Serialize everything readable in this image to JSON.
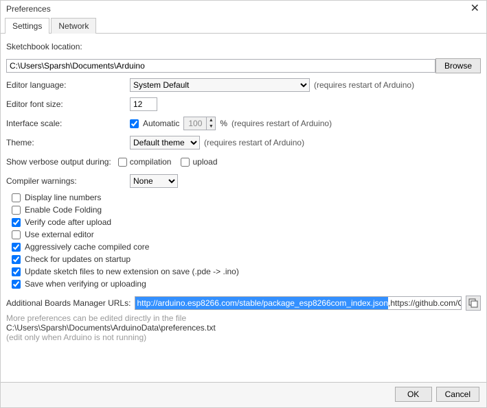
{
  "window": {
    "title": "Preferences"
  },
  "tabs": [
    "Settings",
    "Network"
  ],
  "labels": {
    "sketchbook": "Sketchbook location:",
    "language": "Editor language:",
    "fontsize": "Editor font size:",
    "scale": "Interface scale:",
    "automatic": "Automatic",
    "percent": "%",
    "theme": "Theme:",
    "verbose": "Show verbose output during:",
    "compilation": "compilation",
    "upload": "upload",
    "warnings": "Compiler warnings:",
    "boards_urls": "Additional Boards Manager URLs:"
  },
  "values": {
    "sketchbook": "C:\\Users\\Sparsh\\Documents\\Arduino",
    "language": "System Default",
    "fontsize": "12",
    "scale": "100",
    "theme": "Default theme",
    "warnings": "None",
    "urls_selected": "http://arduino.esp8266.com/stable/package_esp8266com_index.json",
    "urls_rest": ",https://github.com/Optiboot/opt",
    "prefs_path": "C:\\Users\\Sparsh\\Documents\\ArduinoData\\preferences.txt"
  },
  "checks": [
    "Display line numbers",
    "Enable Code Folding",
    "Verify code after upload",
    "Use external editor",
    "Aggressively cache compiled core",
    "Check for updates on startup",
    "Update sketch files to new extension on save (.pde -> .ino)",
    "Save when verifying or uploading"
  ],
  "notes": {
    "restart": "(requires restart of Arduino)",
    "more_prefs": "More preferences can be edited directly in the file",
    "edit_only": "(edit only when Arduino is not running)"
  },
  "buttons": {
    "browse": "Browse",
    "ok": "OK",
    "cancel": "Cancel"
  }
}
